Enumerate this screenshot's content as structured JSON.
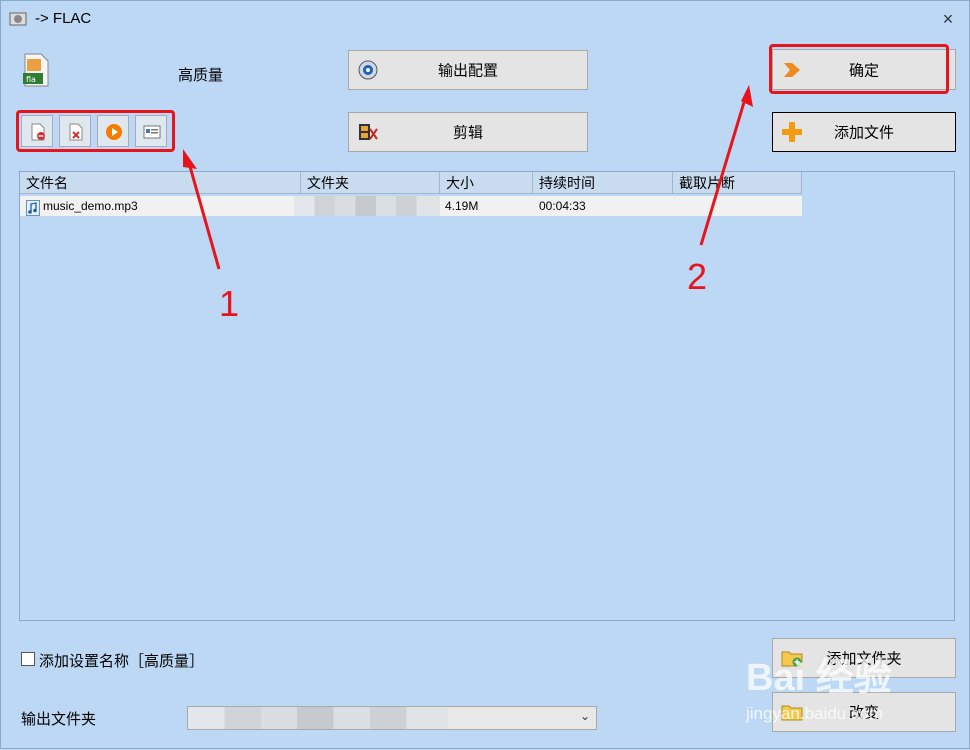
{
  "window": {
    "title": "-> FLAC",
    "close_glyph": "×"
  },
  "profile": {
    "quality": "高质量",
    "format_icon_label": "fla"
  },
  "buttons": {
    "output_config": "输出配置",
    "clip": "剪辑",
    "ok": "确定",
    "add_file": "添加文件",
    "add_folder": "添加文件夹",
    "change": "改变"
  },
  "toolbar": [
    {
      "name": "remove-file-icon"
    },
    {
      "name": "delete-file-icon"
    },
    {
      "name": "play-icon"
    },
    {
      "name": "info-icon"
    }
  ],
  "file_list": {
    "columns": [
      "文件名",
      "文件夹",
      "大小",
      "持续时间",
      "截取片断"
    ],
    "rows": [
      {
        "name": "music_demo.mp3",
        "folder": "",
        "size": "4.19M",
        "duration": "00:04:33",
        "clip": ""
      }
    ]
  },
  "options": {
    "add_setting_name": "添加设置名称［高质量］",
    "add_setting_checked": false
  },
  "output_folder": {
    "label": "输出文件夹",
    "value": ""
  },
  "annotations": {
    "label_1": "1",
    "label_2": "2",
    "color": "#e8141c"
  },
  "watermark": {
    "main": "Bai 经验",
    "sub": "jingyan.baidu.com"
  },
  "colors": {
    "background": "#bcd8f4",
    "header": "#c9dcef",
    "row": "#f1f1f1",
    "annotation": "#e8141c"
  }
}
